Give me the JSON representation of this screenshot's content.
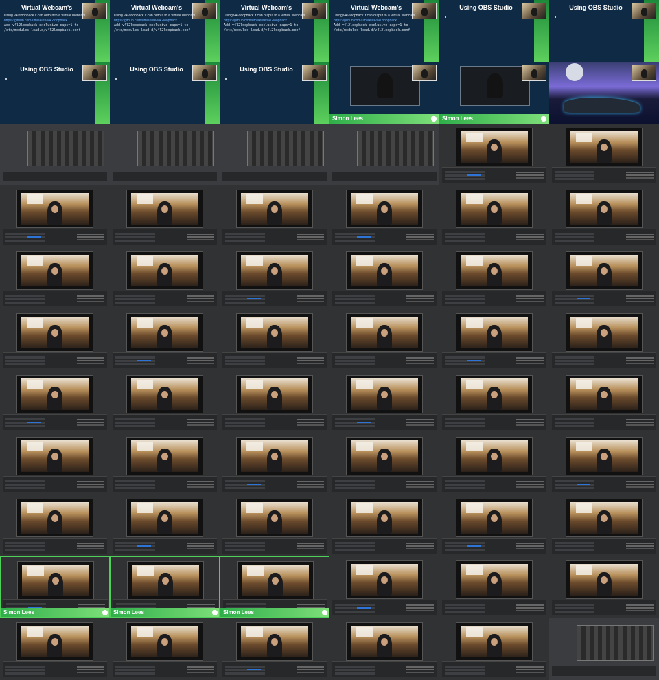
{
  "slides": {
    "virtual_title": "Virtual Webcam's",
    "obs_title": "Using OBS Studio",
    "bullet_1": "Using v4l2loopback it can output to a Virtual Webcam",
    "bullet_link": "https://github.com/umlaeute/v4l2loopback",
    "bullet_2": "Add v4l2loopback exclusive_caps=1 to /etc/modules-load.d/v4l2loopback.conf"
  },
  "lower_third": {
    "name": "Simon Lees"
  },
  "icons": [
    "webcam-pip-icon",
    "lower-third-logo-icon"
  ],
  "colors": {
    "slide_bg": "#0e2a44",
    "accent_green": "#4fd05a",
    "obs_bg": "#303234"
  }
}
